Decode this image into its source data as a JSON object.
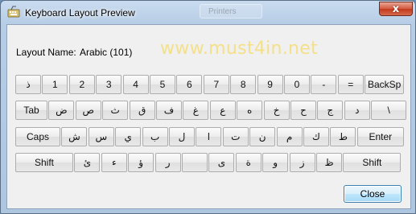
{
  "window": {
    "title": "Keyboard Layout Preview",
    "close_glyph": "x",
    "ghost_tab": "Printers"
  },
  "layout": {
    "label": "Layout Name:",
    "value": "Arabic (101)"
  },
  "watermark": "www.must4in.net",
  "keyboard": {
    "rows": [
      [
        "ذ",
        "1",
        "2",
        "3",
        "4",
        "5",
        "6",
        "7",
        "8",
        "9",
        "0",
        "-",
        "=",
        "BackSp"
      ],
      [
        "Tab",
        "ض",
        "ص",
        "ث",
        "ق",
        "ف",
        "غ",
        "ع",
        "ه",
        "خ",
        "ح",
        "ج",
        "د",
        "\\"
      ],
      [
        "Caps",
        "ش",
        "س",
        "ي",
        "ب",
        "ل",
        "ا",
        "ت",
        "ن",
        "م",
        "ك",
        "ط",
        "Enter"
      ],
      [
        "Shift",
        "ئ",
        "ء",
        "ؤ",
        "ر",
        "",
        "ى",
        "ة",
        "و",
        "ز",
        "ظ",
        "Shift"
      ]
    ]
  },
  "buttons": {
    "close": "Close"
  }
}
